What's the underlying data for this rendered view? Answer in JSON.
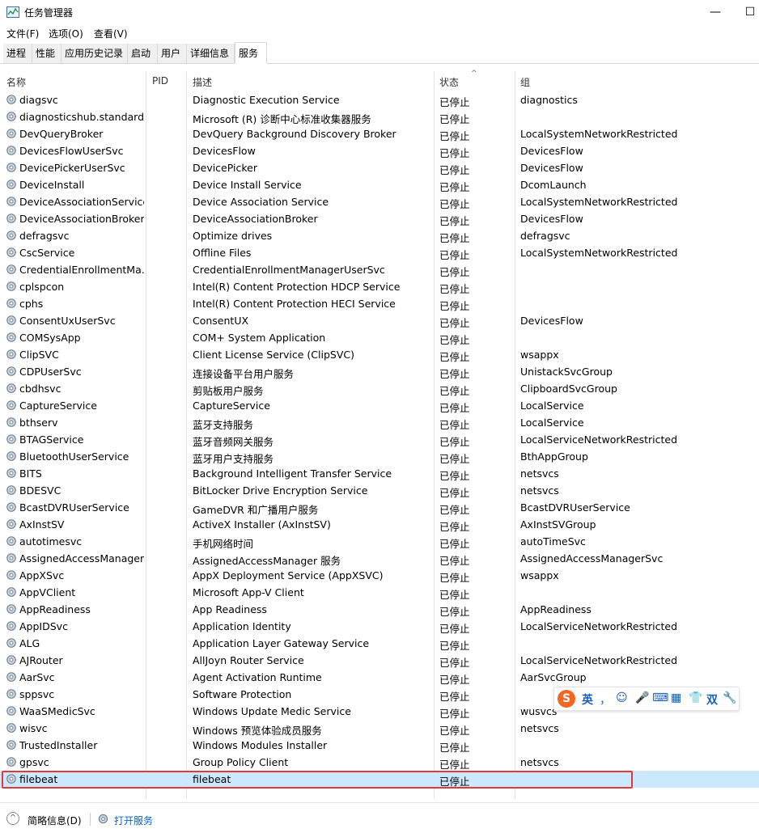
{
  "window": {
    "title": "任务管理器",
    "minimize": "—",
    "maximize": "☐"
  },
  "menu": [
    "文件(F)",
    "选项(O)",
    "查看(V)"
  ],
  "tabs": [
    "进程",
    "性能",
    "应用历史记录",
    "启动",
    "用户",
    "详细信息",
    "服务"
  ],
  "active_tab": "服务",
  "columns": {
    "name": "名称",
    "pid": "PID",
    "desc": "描述",
    "status": "状态",
    "group": "组"
  },
  "rows": [
    {
      "name": "diagsvc",
      "desc": "Diagnostic Execution Service",
      "status": "已停止",
      "group": "diagnostics"
    },
    {
      "name": "diagnosticshub.standard...",
      "desc": "Microsoft (R) 诊断中心标准收集器服务",
      "status": "已停止",
      "group": ""
    },
    {
      "name": "DevQueryBroker",
      "desc": "DevQuery Background Discovery Broker",
      "status": "已停止",
      "group": "LocalSystemNetworkRestricted"
    },
    {
      "name": "DevicesFlowUserSvc",
      "desc": "DevicesFlow",
      "status": "已停止",
      "group": "DevicesFlow"
    },
    {
      "name": "DevicePickerUserSvc",
      "desc": "DevicePicker",
      "status": "已停止",
      "group": "DevicesFlow"
    },
    {
      "name": "DeviceInstall",
      "desc": "Device Install Service",
      "status": "已停止",
      "group": "DcomLaunch"
    },
    {
      "name": "DeviceAssociationService",
      "desc": "Device Association Service",
      "status": "已停止",
      "group": "LocalSystemNetworkRestricted"
    },
    {
      "name": "DeviceAssociationBroker...",
      "desc": "DeviceAssociationBroker",
      "status": "已停止",
      "group": "DevicesFlow"
    },
    {
      "name": "defragsvc",
      "desc": "Optimize drives",
      "status": "已停止",
      "group": "defragsvc"
    },
    {
      "name": "CscService",
      "desc": "Offline Files",
      "status": "已停止",
      "group": "LocalSystemNetworkRestricted"
    },
    {
      "name": "CredentialEnrollmentMa...",
      "desc": "CredentialEnrollmentManagerUserSvc",
      "status": "已停止",
      "group": ""
    },
    {
      "name": "cplspcon",
      "desc": "Intel(R) Content Protection HDCP Service",
      "status": "已停止",
      "group": ""
    },
    {
      "name": "cphs",
      "desc": "Intel(R) Content Protection HECI Service",
      "status": "已停止",
      "group": ""
    },
    {
      "name": "ConsentUxUserSvc",
      "desc": "ConsentUX",
      "status": "已停止",
      "group": "DevicesFlow"
    },
    {
      "name": "COMSysApp",
      "desc": "COM+ System Application",
      "status": "已停止",
      "group": ""
    },
    {
      "name": "ClipSVC",
      "desc": "Client License Service (ClipSVC)",
      "status": "已停止",
      "group": "wsappx"
    },
    {
      "name": "CDPUserSvc",
      "desc": "连接设备平台用户服务",
      "status": "已停止",
      "group": "UnistackSvcGroup"
    },
    {
      "name": "cbdhsvc",
      "desc": "剪贴板用户服务",
      "status": "已停止",
      "group": "ClipboardSvcGroup"
    },
    {
      "name": "CaptureService",
      "desc": "CaptureService",
      "status": "已停止",
      "group": "LocalService"
    },
    {
      "name": "bthserv",
      "desc": "蓝牙支持服务",
      "status": "已停止",
      "group": "LocalService"
    },
    {
      "name": "BTAGService",
      "desc": "蓝牙音频网关服务",
      "status": "已停止",
      "group": "LocalServiceNetworkRestricted"
    },
    {
      "name": "BluetoothUserService",
      "desc": "蓝牙用户支持服务",
      "status": "已停止",
      "group": "BthAppGroup"
    },
    {
      "name": "BITS",
      "desc": "Background Intelligent Transfer Service",
      "status": "已停止",
      "group": "netsvcs"
    },
    {
      "name": "BDESVC",
      "desc": "BitLocker Drive Encryption Service",
      "status": "已停止",
      "group": "netsvcs"
    },
    {
      "name": "BcastDVRUserService",
      "desc": "GameDVR 和广播用户服务",
      "status": "已停止",
      "group": "BcastDVRUserService"
    },
    {
      "name": "AxInstSV",
      "desc": "ActiveX Installer (AxInstSV)",
      "status": "已停止",
      "group": "AxInstSVGroup"
    },
    {
      "name": "autotimesvc",
      "desc": "手机网络时间",
      "status": "已停止",
      "group": "autoTimeSvc"
    },
    {
      "name": "AssignedAccessManager...",
      "desc": "AssignedAccessManager 服务",
      "status": "已停止",
      "group": "AssignedAccessManagerSvc"
    },
    {
      "name": "AppXSvc",
      "desc": "AppX Deployment Service (AppXSVC)",
      "status": "已停止",
      "group": "wsappx"
    },
    {
      "name": "AppVClient",
      "desc": "Microsoft App-V Client",
      "status": "已停止",
      "group": ""
    },
    {
      "name": "AppReadiness",
      "desc": "App Readiness",
      "status": "已停止",
      "group": "AppReadiness"
    },
    {
      "name": "AppIDSvc",
      "desc": "Application Identity",
      "status": "已停止",
      "group": "LocalServiceNetworkRestricted"
    },
    {
      "name": "ALG",
      "desc": "Application Layer Gateway Service",
      "status": "已停止",
      "group": ""
    },
    {
      "name": "AJRouter",
      "desc": "AllJoyn Router Service",
      "status": "已停止",
      "group": "LocalServiceNetworkRestricted"
    },
    {
      "name": "AarSvc",
      "desc": "Agent Activation Runtime",
      "status": "已停止",
      "group": "AarSvcGroup"
    },
    {
      "name": "sppsvc",
      "desc": "Software Protection",
      "status": "已停止",
      "group": ""
    },
    {
      "name": "WaaSMedicSvc",
      "desc": "Windows Update Medic Service",
      "status": "已停止",
      "group": "wusvcs"
    },
    {
      "name": "wisvc",
      "desc": "Windows 预览体验成员服务",
      "status": "已停止",
      "group": "netsvcs"
    },
    {
      "name": "TrustedInstaller",
      "desc": "Windows Modules Installer",
      "status": "已停止",
      "group": ""
    },
    {
      "name": "gpsvc",
      "desc": "Group Policy Client",
      "status": "已停止",
      "group": "netsvcs"
    },
    {
      "name": "filebeat",
      "desc": "filebeat",
      "status": "已停止",
      "group": "",
      "selected": true
    }
  ],
  "footer": {
    "less_details": "简略信息(D)",
    "open_services": "打开服务"
  },
  "ime": {
    "logo": "S",
    "lang": "英",
    "punct": "，",
    "emoji": "☺",
    "mic": "🎤",
    "keyboard": "⌨",
    "skin": "👕",
    "mode": "双",
    "settings": "🔧"
  }
}
